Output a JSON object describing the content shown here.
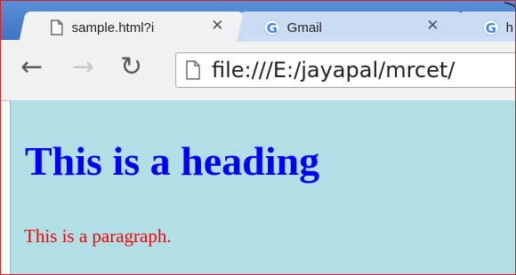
{
  "tabs": [
    {
      "title": "sample.html?i",
      "icon": "page-icon",
      "active": true
    },
    {
      "title": "Gmail",
      "icon": "google-icon",
      "active": false
    },
    {
      "title": "h",
      "icon": "google-icon",
      "active": false
    }
  ],
  "toolbar": {
    "back_icon": "arrow-left-icon",
    "forward_icon": "arrow-right-icon",
    "reload_icon": "reload-icon"
  },
  "omnibox": {
    "url": "file:///E:/jayapal/mrcet/"
  },
  "page": {
    "heading": "This is a heading",
    "paragraph": "This is a paragraph.",
    "background_color": "#b0dfe5",
    "heading_color": "#0000ff",
    "paragraph_color": "#ff0000"
  }
}
